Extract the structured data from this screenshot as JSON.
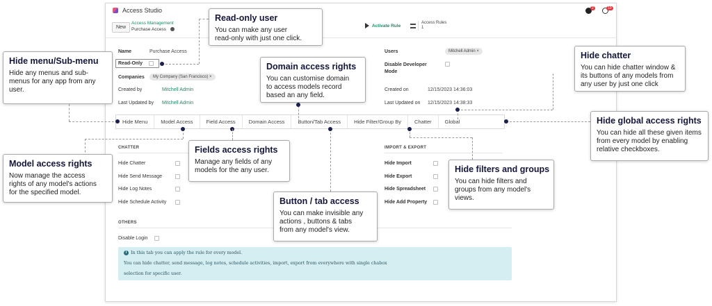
{
  "app": {
    "title": "Access Studio"
  },
  "control": {
    "new_label": "New",
    "breadcrumb_parent": "Access Management",
    "breadcrumb_current": "Purchase Access",
    "activate_label": "Activate Rule",
    "rules_label": "Access Rules",
    "rules_count": "1"
  },
  "systray": {
    "chat_badge": "2",
    "activity_badge": "10"
  },
  "form": {
    "name_label": "Name",
    "name_value": "Purchase Access",
    "readonly_label": "Read-Only",
    "companies_label": "Companies",
    "companies_tag": "My Company (San Francisco) ×",
    "created_by_label": "Created by",
    "created_by_value": "Mitchell Admin",
    "updated_by_label": "Last Updated by",
    "updated_by_value": "Mitchell Admin",
    "users_label": "Users",
    "users_tag": "Mitchell Admin ×",
    "dev_mode_label_1": "Disable Developer",
    "dev_mode_label_2": "Mode",
    "created_on_label": "Created on",
    "created_on_value": "12/15/2023 14:36:03",
    "updated_on_label": "Last Updated on",
    "updated_on_value": "12/15/2023 14:38:33"
  },
  "tabs": [
    "Hide Menu",
    "Model Access",
    "Field Access",
    "Domain Access",
    "Button/Tab Access",
    "Hide Filter/Group By",
    "Chatter",
    "Global"
  ],
  "chatter_section": {
    "title": "CHATTER",
    "items": [
      "Hide Chatter",
      "Hide Send Message",
      "Hide Log Notes",
      "Hide Schedule Activity"
    ]
  },
  "import_section": {
    "title": "IMPORT & EXPORT",
    "items": [
      "Hide Import",
      "Hide Export",
      "Hide Spreadsheet",
      "Hide Add Property"
    ]
  },
  "others_section": {
    "title": "OTHERS",
    "disable_login_label": "Disable Login"
  },
  "info": {
    "line1": "In this tab you can apply the rule for every model.",
    "line2": "You can hide chatter, send message, log notes, schedule activities, import, export from everywhere with single chabox",
    "line3": "selection for specific user."
  },
  "callouts": {
    "readonly": {
      "title": "Read-only user",
      "l1": "You can make any user",
      "l2": "read-only with just one click."
    },
    "hidemenu": {
      "title": "Hide menu/Sub-menu",
      "l1": "Hide any menus and sub-",
      "l2": "menus for any app from any",
      "l3": "user."
    },
    "domain": {
      "title": "Domain access rights",
      "l1": "You can customise domain",
      "l2": "to access models record",
      "l3": "based an any field."
    },
    "chatter": {
      "title": "Hide chatter",
      "l1": "You can hide chatter window &",
      "l2": "its buttons of any models from",
      "l3": "any user by just one click"
    },
    "global": {
      "title": "Hide global access rights",
      "l1": "You can hide all these given items",
      "l2": "from every model by enabling",
      "l3": "relative checkboxes."
    },
    "model": {
      "title": "Model access rights",
      "l1": "Now manage the access",
      "l2": "rights of any model's actions",
      "l3": "for the specified model."
    },
    "fields": {
      "title": "Fields access rights",
      "l1": "Manage any fields of any",
      "l2": "models for the any user."
    },
    "button": {
      "title": "Button / tab access",
      "l1": "You can make invisible any",
      "l2": "actions , buttons & tabs",
      "l3": "from any model's view."
    },
    "filters": {
      "title": "Hide filters and groups",
      "l1": "You can hide filters and",
      "l2": "groups from any model's",
      "l3": "views."
    }
  }
}
